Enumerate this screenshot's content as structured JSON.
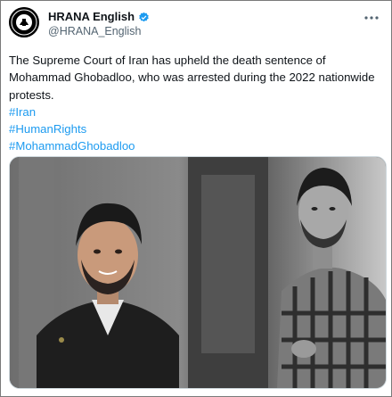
{
  "account": {
    "display_name": "HRANA English",
    "handle": "@HRANA_English",
    "verified_icon": "verified-badge-icon",
    "avatar_icon": "hrana-logo-icon"
  },
  "more_icon": "more-options-icon",
  "tweet": {
    "text": "The Supreme Court of Iran has upheld the death sentence of Mohammad Ghobadloo, who was arrested during the 2022 nationwide protests.",
    "hashtags": [
      "#Iran",
      "#HumanRights",
      "#MohammadGhobadloo"
    ]
  },
  "media": {
    "description_icon": "photo-of-two-portraits"
  },
  "colors": {
    "link": "#1d9bf0",
    "verified": "#1d9bf0",
    "secondary_text": "#536471"
  }
}
